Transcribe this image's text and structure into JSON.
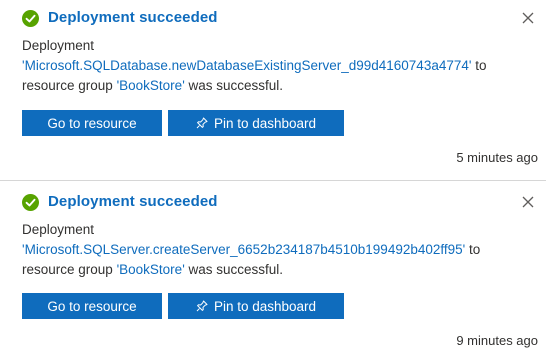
{
  "notifications": [
    {
      "title": "Deployment succeeded",
      "line_prefix": "Deployment",
      "quote": "'",
      "deployment_name": "Microsoft.SQLDatabase.newDatabaseExistingServer_d99d4160743a4774",
      "mid_text": "' to resource group '",
      "resource_group": "BookStore",
      "suffix_text": "' was successful.",
      "go_button": "Go to resource",
      "pin_button": "Pin to dashboard",
      "time": "5 minutes ago"
    },
    {
      "title": "Deployment succeeded",
      "line_prefix": "Deployment",
      "quote": "'",
      "deployment_name": "Microsoft.SQLServer.createServer_6652b234187b4510b199492b402ff95",
      "mid_text": "' to resource group '",
      "resource_group": "BookStore",
      "suffix_text": "' was successful.",
      "go_button": "Go to resource",
      "pin_button": "Pin to dashboard",
      "time": "9 minutes ago"
    }
  ],
  "icons": {
    "status": "check-circle-icon",
    "close": "close-icon",
    "pin": "pin-icon"
  },
  "colors": {
    "success": "#57a300",
    "accent": "#0f6cbd"
  }
}
